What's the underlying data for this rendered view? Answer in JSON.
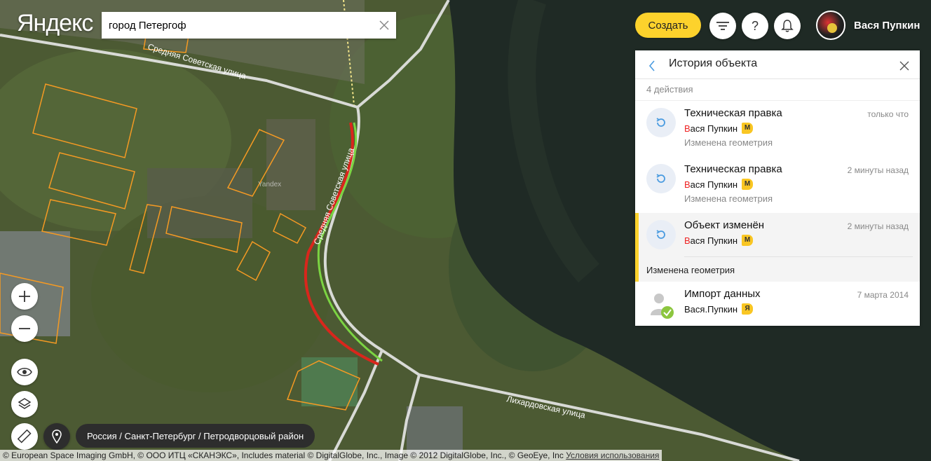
{
  "logo": "Яндекс",
  "search": {
    "value": "город Петергоф"
  },
  "header": {
    "create_label": "Создать",
    "user_name": "Вася Пупкин"
  },
  "map": {
    "street_labels": [
      "Средняя Советская улица",
      "Лихардовская улица"
    ],
    "watermark": "Yandex",
    "colors": {
      "water": "#1f2a25",
      "building_outline": "#f59a23",
      "road": "#e8e8e8",
      "route_old": "#d9261c",
      "route_new": "#7bd442"
    }
  },
  "panel": {
    "title": "История объекта",
    "count": "4 действия",
    "items": [
      {
        "title": "Техническая правка",
        "author_first": "В",
        "author_rest": "ася Пупкин",
        "badge": "М",
        "time": "только что",
        "desc": "Изменена геометрия",
        "icon": "revert-icon"
      },
      {
        "title": "Техническая правка",
        "author_first": "В",
        "author_rest": "ася Пупкин",
        "badge": "М",
        "time": "2 минуты назад",
        "desc": "Изменена геометрия",
        "icon": "revert-icon"
      },
      {
        "title": "Объект изменён",
        "author_first": "В",
        "author_rest": "ася Пупкин",
        "badge": "М",
        "time": "2 минуты назад",
        "desc": "Изменена геометрия",
        "icon": "revert-icon",
        "selected": true
      },
      {
        "title": "Импорт данных",
        "author_first": "",
        "author_rest": "Вася.Пупкин",
        "badge": "Я",
        "time": "7 марта 2014",
        "desc": "",
        "icon": "import-user-icon"
      }
    ]
  },
  "breadcrumb": "Россия / Санкт-Петербург / Петродворцовый район",
  "copyright": {
    "text": "© European Space Imaging GmbH, © ООО ИТЦ «СКАНЭКС», Includes material © DigitalGlobe, Inc., Image © 2012 DigitalGlobe, Inc., © GeoEye, Inc",
    "link": "Условия использования"
  }
}
